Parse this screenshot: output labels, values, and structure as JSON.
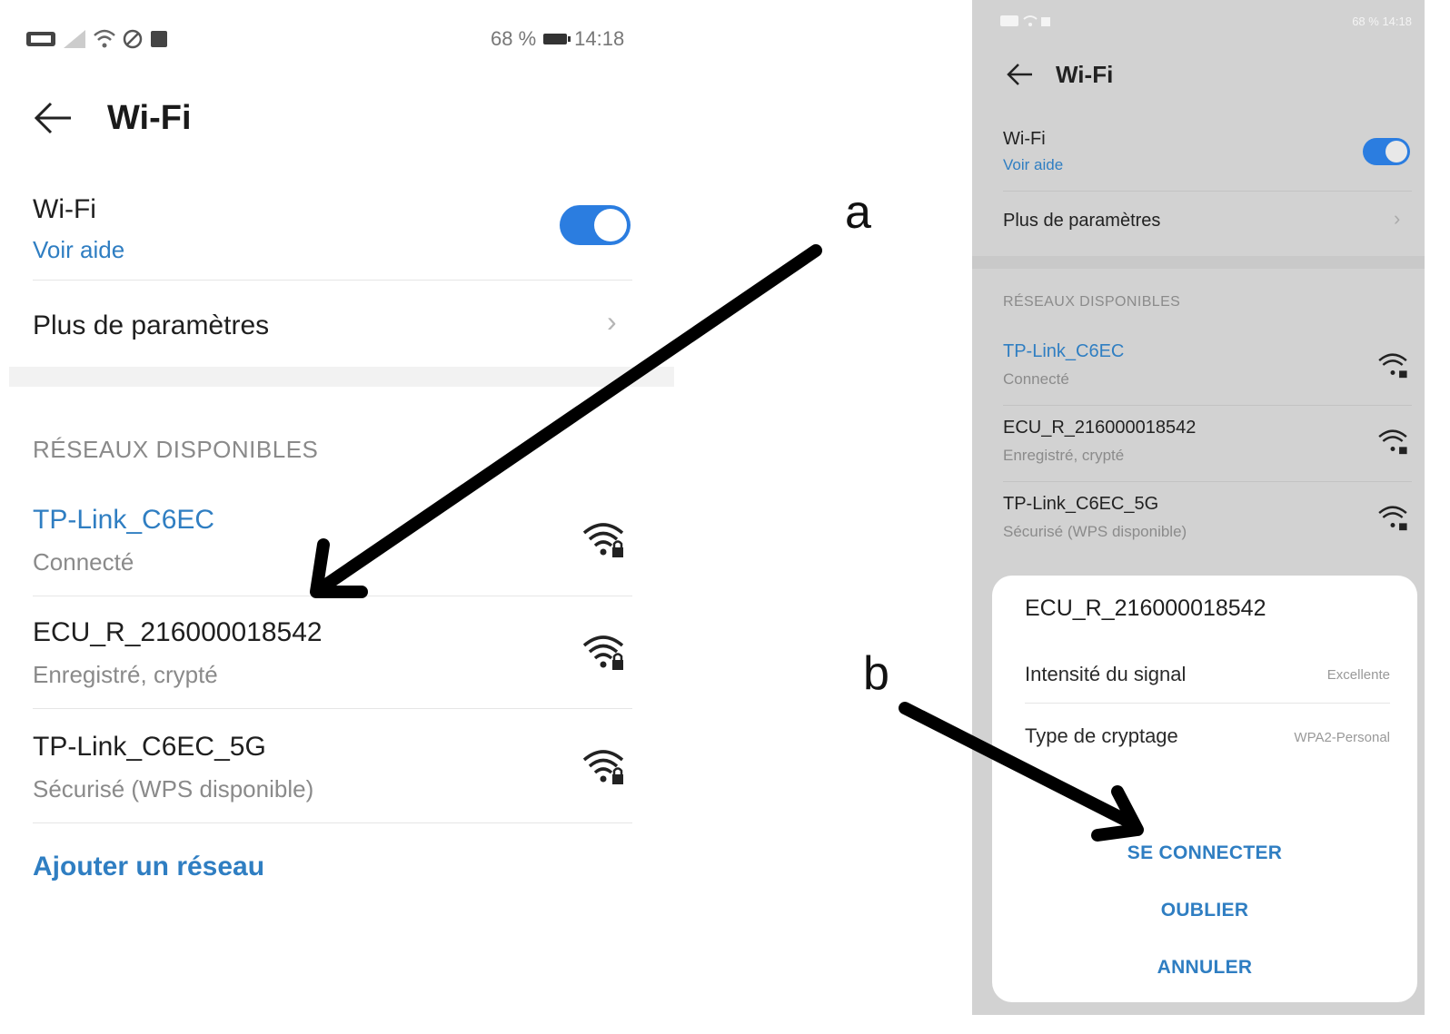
{
  "left_phone": {
    "status_bar": {
      "battery_percent": "68 %",
      "time": "14:18"
    },
    "header": {
      "title": "Wi-Fi"
    },
    "wifi_toggle": {
      "label": "Wi-Fi",
      "help_link": "Voir aide",
      "enabled": true
    },
    "more_settings": {
      "label": "Plus de paramètres"
    },
    "available_networks_header": "RÉSEAUX DISPONIBLES",
    "networks": [
      {
        "name": "TP-Link_C6EC",
        "status": "Connecté",
        "connected": true,
        "icon": "wifi-lock-icon"
      },
      {
        "name": "ECU_R_216000018542",
        "status": "Enregistré, crypté",
        "connected": false,
        "icon": "wifi-lock-icon"
      },
      {
        "name": "TP-Link_C6EC_5G",
        "status": "Sécurisé (WPS disponible)",
        "connected": false,
        "icon": "wifi-lock-icon"
      }
    ],
    "add_network": "Ajouter un réseau"
  },
  "right_phone": {
    "status_bar": {
      "battery_percent": "68 %",
      "time": "14:18"
    },
    "header": {
      "title": "Wi-Fi"
    },
    "wifi_toggle": {
      "label": "Wi-Fi",
      "help_link": "Voir aide",
      "enabled": true
    },
    "more_settings": {
      "label": "Plus de paramètres"
    },
    "available_networks_header": "RÉSEAUX DISPONIBLES",
    "networks": [
      {
        "name": "TP-Link_C6EC",
        "status": "Connecté",
        "connected": true
      },
      {
        "name": "ECU_R_216000018542",
        "status": "Enregistré, crypté",
        "connected": false
      },
      {
        "name": "TP-Link_C6EC_5G",
        "status": "Sécurisé (WPS disponible)",
        "connected": false
      }
    ],
    "dialog": {
      "title": "ECU_R_216000018542",
      "signal_label": "Intensité du signal",
      "signal_value": "Excellente",
      "encryption_label": "Type de cryptage",
      "encryption_value": "WPA2-Personal",
      "connect_button": "SE CONNECTER",
      "forget_button": "OUBLIER",
      "cancel_button": "ANNULER"
    }
  },
  "annotations": {
    "a": "a",
    "b": "b"
  },
  "colors": {
    "accent_blue": "#2f7ec2",
    "toggle_blue": "#2b7de0",
    "dim_background": "#d2d2d2"
  }
}
